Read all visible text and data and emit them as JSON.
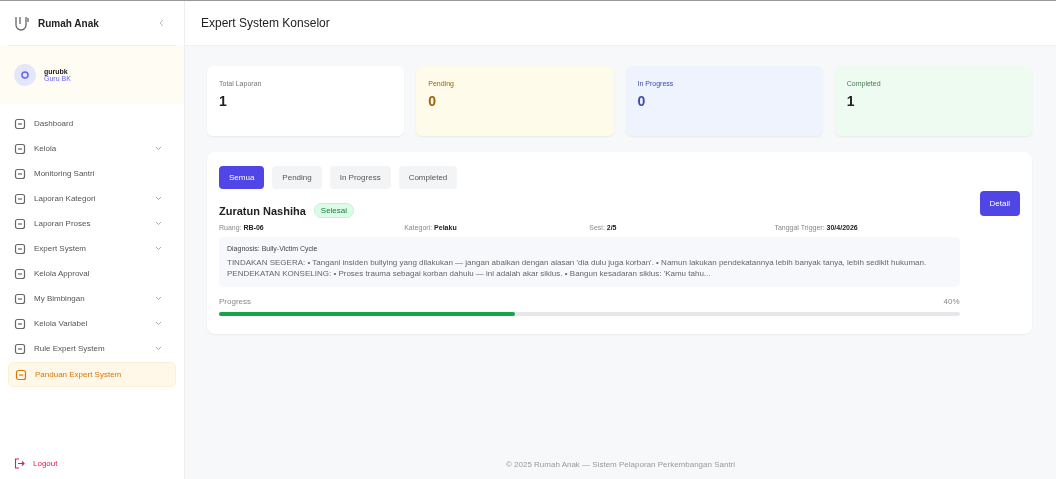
{
  "sidebar": {
    "brand": "Rumah Anak",
    "user": {
      "name": "gurubk",
      "role": "Guru BK"
    },
    "items": [
      {
        "label": "Dashboard",
        "expandable": false,
        "selected": false
      },
      {
        "label": "Kelola",
        "expandable": true,
        "selected": false
      },
      {
        "label": "Monitoring Santri",
        "expandable": false,
        "selected": false
      },
      {
        "label": "Laporan Kategori",
        "expandable": true,
        "selected": false
      },
      {
        "label": "Laporan Proses",
        "expandable": true,
        "selected": false
      },
      {
        "label": "Expert System",
        "expandable": true,
        "selected": false
      },
      {
        "label": "Kelola Approval",
        "expandable": false,
        "selected": false
      },
      {
        "label": "My Bimbingan",
        "expandable": true,
        "selected": false
      },
      {
        "label": "Kelola Variabel",
        "expandable": true,
        "selected": false
      },
      {
        "label": "Rule Expert System",
        "expandable": true,
        "selected": false
      },
      {
        "label": "Panduan Expert System",
        "expandable": false,
        "selected": true
      }
    ],
    "logout": "Logout"
  },
  "header": {
    "title": "Expert System Konselor"
  },
  "stats": [
    {
      "kind": "total",
      "label": "Total Laporan",
      "value": "1"
    },
    {
      "kind": "pending",
      "label": "Pending",
      "value": "0"
    },
    {
      "kind": "progress",
      "label": "In Progress",
      "value": "0"
    },
    {
      "kind": "done",
      "label": "Completed",
      "value": "1"
    }
  ],
  "tabs": [
    {
      "label": "Semua",
      "selected": true
    },
    {
      "label": "Pending",
      "selected": false
    },
    {
      "label": "In Progress",
      "selected": false
    },
    {
      "label": "Completed",
      "selected": false
    }
  ],
  "reports": [
    {
      "name": "Zuratun Nashiha",
      "badge": "Selesai",
      "meta": [
        {
          "label": "Ruang:",
          "value": "RB-06"
        },
        {
          "label": "Kategori:",
          "value": "Pelaku"
        },
        {
          "label": "Sesi:",
          "value": "2/5"
        },
        {
          "label": "Tanggal Trigger:",
          "value": "30/4/2026"
        }
      ],
      "diagnosis": "Diagnosis: Bully-Victim Cycle",
      "summary": "TINDAKAN SEGERA: • Tangani insiden bullying yang dilakukan — jangan abaikan dengan alasan 'dia dulu juga korban'. • Namun lakukan pendekatannya lebih banyak tanya, lebih sedikit hukuman. PENDEKATAN KONSELING: • Proses trauma sebagai korban dahulu — ini adalah akar siklus. • Bangun kesadaran siklus: 'Kamu tahu...",
      "progress_label": "Progress",
      "level": 0.4,
      "reading": "40%",
      "button": "Detail"
    }
  ],
  "footer": "© 2025 Rumah Anak — Sistem Pelaporan Perkembangan Santri"
}
